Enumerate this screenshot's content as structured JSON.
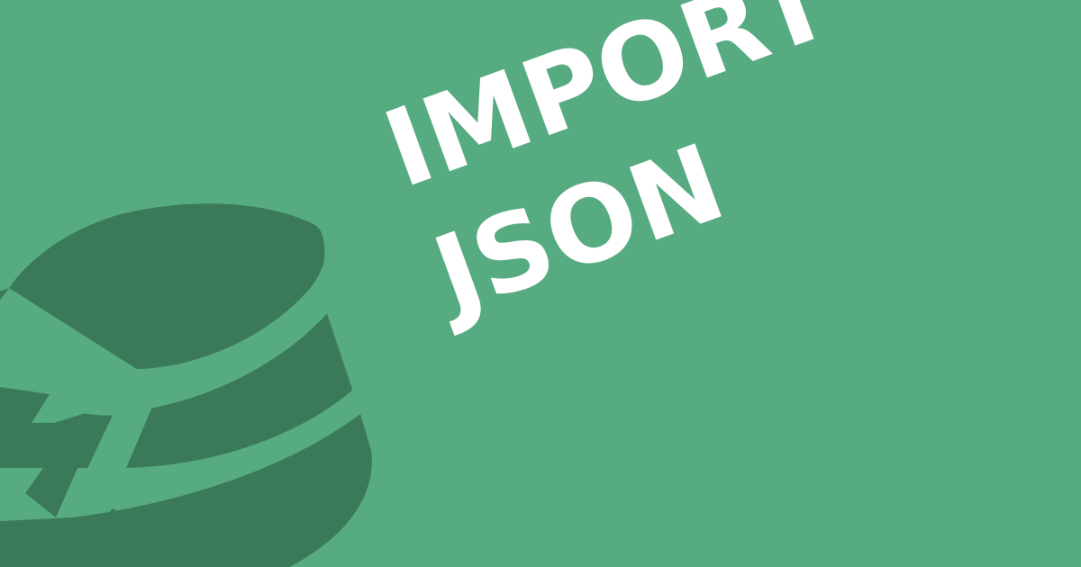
{
  "title": {
    "line1": "IMPORT",
    "line2": "JSON"
  },
  "icon": {
    "name": "database-import-icon"
  },
  "colors": {
    "background": "#57ab81",
    "icon": "#3b7a59",
    "text": "#ffffff"
  }
}
